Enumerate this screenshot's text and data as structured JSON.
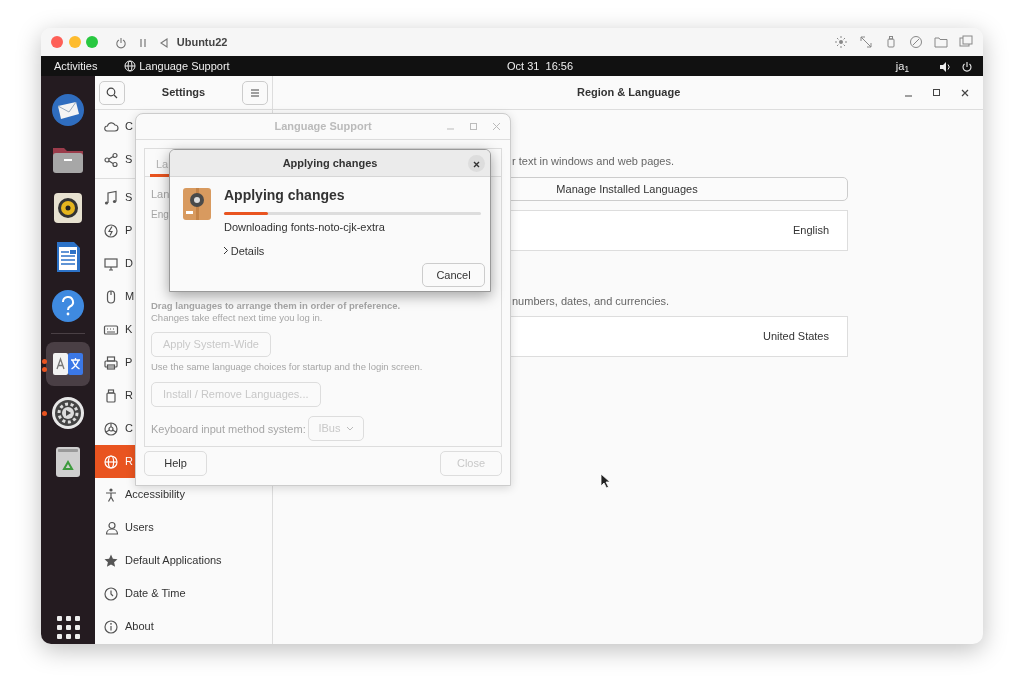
{
  "vm_window": {
    "title": "Ubuntu22"
  },
  "top_bar": {
    "activities": "Activities",
    "app_menu": "Language Support",
    "clock": "Oct 31  16:56",
    "input_method": "ja$_{1}$"
  },
  "dock": {
    "items": [
      {
        "kind": "mail",
        "running": false,
        "focused": false
      },
      {
        "kind": "files",
        "running": false,
        "focused": false
      },
      {
        "kind": "music",
        "running": false,
        "focused": false
      },
      {
        "kind": "writer",
        "running": false,
        "focused": false
      },
      {
        "kind": "help",
        "running": false,
        "focused": false
      },
      {
        "kind": "translate",
        "running": true,
        "focused": true
      },
      {
        "kind": "settings",
        "running": true,
        "focused": false
      },
      {
        "kind": "trash",
        "running": false,
        "focused": false
      }
    ]
  },
  "settings": {
    "sidebar": {
      "title": "Settings",
      "sections": [
        {
          "items": [
            {
              "kind": "cloud",
              "label": "C",
              "selected": false
            },
            {
              "kind": "share",
              "label": "S",
              "selected": false
            }
          ]
        },
        {
          "items": [
            {
              "kind": "note",
              "label": "S",
              "selected": false
            },
            {
              "kind": "power",
              "label": "P",
              "selected": false
            },
            {
              "kind": "display",
              "label": "D",
              "selected": false
            },
            {
              "kind": "mouse",
              "label": "M",
              "selected": false
            },
            {
              "kind": "keyboard",
              "label": "K",
              "selected": false
            },
            {
              "kind": "printer",
              "label": "P",
              "selected": false
            },
            {
              "kind": "usb",
              "label": "R",
              "selected": false
            },
            {
              "kind": "color",
              "label": "C",
              "selected": false
            },
            {
              "kind": "globe",
              "label": "R",
              "selected": true
            },
            {
              "kind": "person",
              "label": "Accessibility",
              "selected": false
            },
            {
              "kind": "users",
              "label": "Users",
              "selected": false
            },
            {
              "kind": "star",
              "label": "Default Applications",
              "selected": false
            },
            {
              "kind": "clock",
              "label": "Date & Time",
              "selected": false
            },
            {
              "kind": "info",
              "label": "About",
              "selected": false
            }
          ]
        }
      ]
    },
    "main": {
      "title": "Region & Language",
      "language_description": "r text in windows and web pages.",
      "manage_button": "Manage Installed Languages",
      "language_value": "English",
      "formats_description": "numbers, dates, and currencies.",
      "formats_value": "United States"
    }
  },
  "language_support": {
    "title": "Language Support",
    "tab": {
      "label": "La",
      "selected": true
    },
    "language_label": "Lan",
    "language_item": "Eng",
    "drag_hint": "Drag languages to arrange them in order of preference.",
    "changes_note": "Changes take effect next time you log in.",
    "apply_button": {
      "label": "Apply System-Wide",
      "disabled": true
    },
    "apply_note": "Use the same language choices for startup and the login screen.",
    "install_button": {
      "label": "Install / Remove Languages...",
      "disabled": true
    },
    "im_label": "Keyboard input method system:",
    "im_select": {
      "value": "IBus",
      "disabled": true
    },
    "help_button": {
      "label": "Help",
      "disabled": false
    },
    "close_button": {
      "label": "Close",
      "disabled": true
    }
  },
  "dialog": {
    "title": "Applying changes",
    "heading": "Applying changes",
    "progress": {
      "level": 0.17
    },
    "status": "Downloading fonts-noto-cjk-extra",
    "details": {
      "label": "Details",
      "expanded": false
    },
    "cancel_button": "Cancel"
  }
}
